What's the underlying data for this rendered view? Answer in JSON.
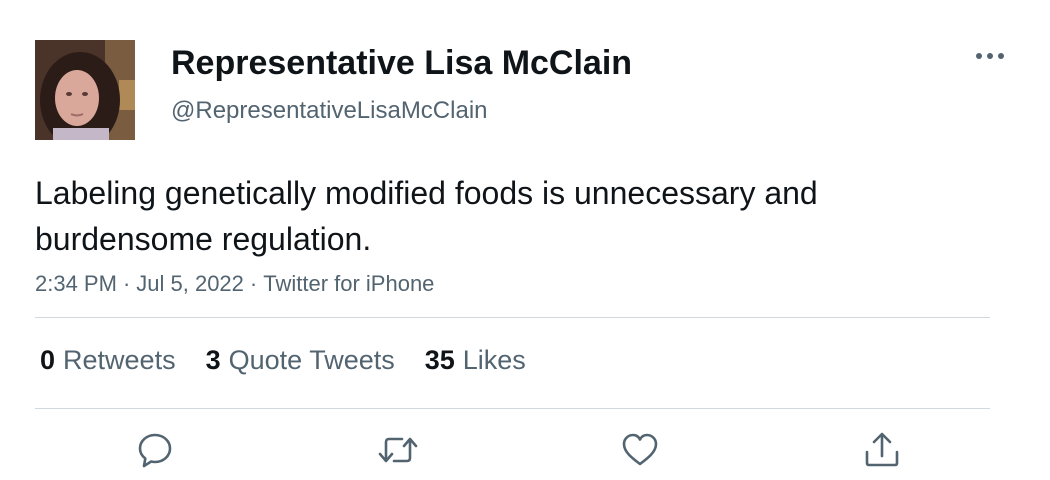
{
  "author": {
    "display_name": "Representative Lisa McClain",
    "handle": "@RepresentativeLisaMcClain",
    "avatar_icon": "profile-photo"
  },
  "tweet": {
    "text": "Labeling genetically modified foods is unnecessary and burdensome regulation.",
    "time": "2:34 PM",
    "date": "Jul 5, 2022",
    "source": "Twitter for iPhone",
    "separator": "·"
  },
  "stats": {
    "retweets": {
      "count": "0",
      "label": "Retweets"
    },
    "quote_tweets": {
      "count": "3",
      "label": "Quote Tweets"
    },
    "likes": {
      "count": "35",
      "label": "Likes"
    }
  },
  "actions": [
    {
      "name": "reply",
      "icon": "reply-icon"
    },
    {
      "name": "retweet",
      "icon": "retweet-icon"
    },
    {
      "name": "like",
      "icon": "heart-icon"
    },
    {
      "name": "share",
      "icon": "share-icon"
    }
  ],
  "colors": {
    "text_primary": "#0f1419",
    "text_secondary": "#536471",
    "divider": "#cfd9de"
  }
}
